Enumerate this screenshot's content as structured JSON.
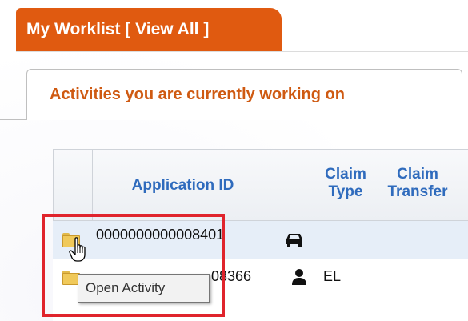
{
  "worklist": {
    "title": "My Worklist [ View All ]"
  },
  "tabs": [
    {
      "label": "Activities you are currently working on",
      "active": true
    }
  ],
  "table": {
    "headers": {
      "application_id": "Application ID",
      "claim_type_line1": "Claim",
      "claim_type_line2": "Type",
      "claim_transfer_line1": "Claim",
      "claim_transfer_line2": "Transfer"
    },
    "rows": [
      {
        "application_id": "0000000000008401",
        "claim_type_icon": "car-icon",
        "claim_type_text": "",
        "selected": true
      },
      {
        "application_id_visible": "08366",
        "claim_type_icon": "person-icon",
        "claim_type_text": "EL"
      }
    ]
  },
  "tooltip": {
    "text": "Open Activity"
  },
  "colors": {
    "tab_orange": "#e05a10",
    "tab_text_orange": "#cf5a12",
    "header_blue": "#2f6bbd",
    "selected_row": "#e6eef8",
    "highlight_red": "#e0242c"
  }
}
